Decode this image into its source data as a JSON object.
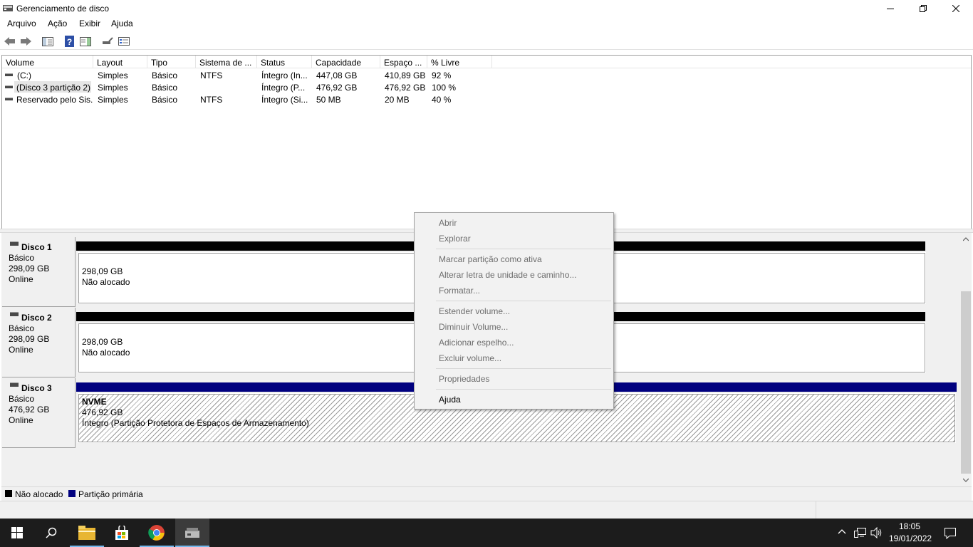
{
  "window": {
    "title": "Gerenciamento de disco"
  },
  "menu": [
    "Arquivo",
    "Ação",
    "Exibir",
    "Ajuda"
  ],
  "columns": [
    "Volume",
    "Layout",
    "Tipo",
    "Sistema de ...",
    "Status",
    "Capacidade",
    "Espaço ...",
    "% Livre"
  ],
  "volumes": [
    [
      "(C:)",
      "Simples",
      "Básico",
      "NTFS",
      "Íntegro (In...",
      "447,08 GB",
      "410,89 GB",
      "92 %"
    ],
    [
      "(Disco 3 partição 2)",
      "Simples",
      "Básico",
      "",
      "Íntegro (P...",
      "476,92 GB",
      "476,92 GB",
      "100 %"
    ],
    [
      "Reservado pelo Sis...",
      "Simples",
      "Básico",
      "NTFS",
      "Íntegro (Si...",
      "50 MB",
      "20 MB",
      "40 %"
    ]
  ],
  "disks": [
    {
      "name": "Disco 1",
      "type": "Básico",
      "size": "298,09 GB",
      "state": "Online",
      "part_size": "298,09 GB",
      "part_status": "Não alocado"
    },
    {
      "name": "Disco 2",
      "type": "Básico",
      "size": "298,09 GB",
      "state": "Online",
      "part_size": "298,09 GB",
      "part_status": "Não alocado"
    },
    {
      "name": "Disco 3",
      "type": "Básico",
      "size": "476,92 GB",
      "state": "Online",
      "part_name": "NVME",
      "part_size": "476,92 GB",
      "part_status": "Íntegro (Partição Protetora de Espaços de Armazenamento)"
    }
  ],
  "legend": {
    "unallocated": "Não alocado",
    "primary": "Partição primária"
  },
  "colors": {
    "unallocated": "#000000",
    "primary": "#00007f"
  },
  "context_menu": {
    "items": [
      {
        "label": "Abrir",
        "enabled": false
      },
      {
        "label": "Explorar",
        "enabled": false
      },
      {
        "label": "Marcar partição como ativa",
        "enabled": false
      },
      {
        "label": "Alterar letra de unidade e caminho...",
        "enabled": false
      },
      {
        "label": "Formatar...",
        "enabled": false
      },
      {
        "label": "Estender volume...",
        "enabled": false
      },
      {
        "label": "Diminuir Volume...",
        "enabled": false
      },
      {
        "label": "Adicionar espelho...",
        "enabled": false
      },
      {
        "label": "Excluir volume...",
        "enabled": false
      },
      {
        "label": "Propriedades",
        "enabled": false
      },
      {
        "label": "Ajuda",
        "enabled": true
      }
    ]
  },
  "taskbar": {
    "time": "18:05",
    "date": "19/01/2022"
  }
}
